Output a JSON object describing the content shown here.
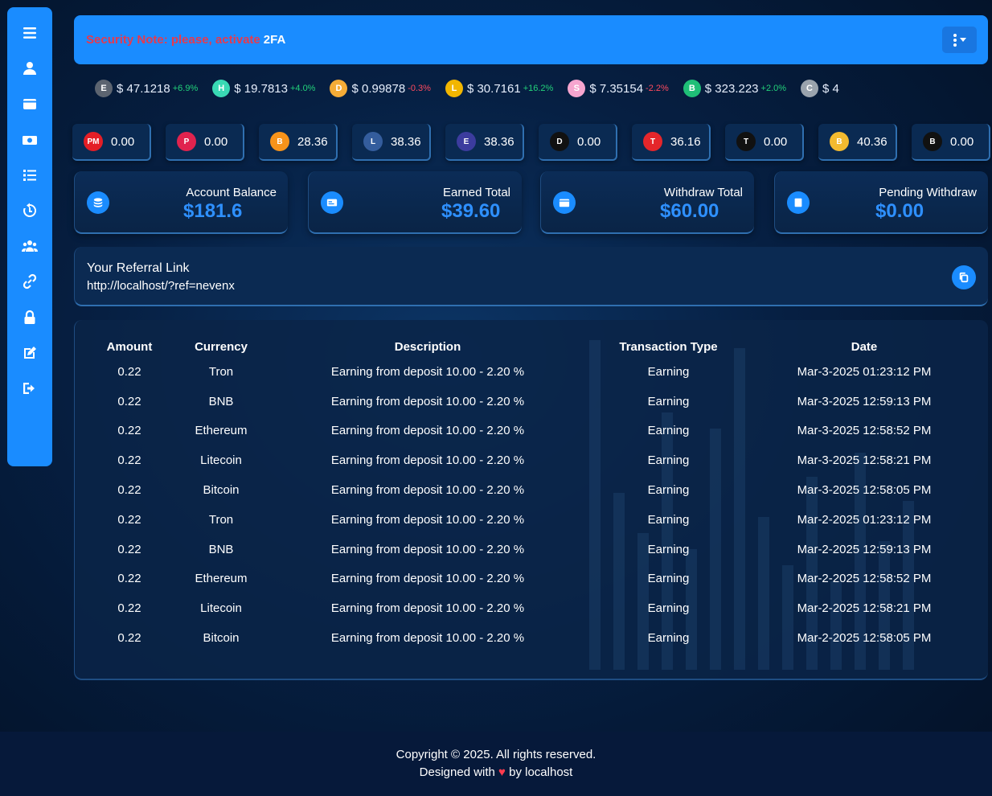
{
  "security": {
    "note": "Security Note: please, activate",
    "strong": "2FA"
  },
  "ticker": [
    {
      "icon": "ethereum-classic-icon",
      "color": "#5c6470",
      "glyph": "E",
      "price": "$ 47.1218",
      "change": "+6.9%",
      "dir": "up"
    },
    {
      "icon": "hedera-icon",
      "color": "#39d9b4",
      "glyph": "H",
      "price": "$ 19.7813",
      "change": "+4.0%",
      "dir": "up"
    },
    {
      "icon": "dai-icon",
      "color": "#f5ac37",
      "glyph": "D",
      "price": "$ 0.99878",
      "change": "-0.3%",
      "dir": "down"
    },
    {
      "icon": "terra-icon",
      "color": "#f2b600",
      "glyph": "L",
      "price": "$ 30.7161",
      "change": "+16.2%",
      "dir": "up"
    },
    {
      "icon": "shiba-icon",
      "color": "#f6a5cf",
      "glyph": "S",
      "price": "$ 7.35154",
      "change": "-2.2%",
      "dir": "down"
    },
    {
      "icon": "bitcoin-cash-icon",
      "color": "#1fbf77",
      "glyph": "B",
      "price": "$ 323.223",
      "change": "+2.0%",
      "dir": "up"
    },
    {
      "icon": "chainlink-icon",
      "color": "#9aa3ad",
      "glyph": "C",
      "price": "$ 4",
      "change": "",
      "dir": "up"
    }
  ],
  "wallets": [
    {
      "icon": "perfect-money-icon",
      "color": "#e41e26",
      "glyph": "PM",
      "value": "0.00"
    },
    {
      "icon": "payeer-icon",
      "color": "#e0234e",
      "glyph": "P",
      "value": "0.00"
    },
    {
      "icon": "bitcoin-icon",
      "color": "#f7931a",
      "glyph": "B",
      "value": "28.36"
    },
    {
      "icon": "litecoin-icon",
      "color": "#345d9d",
      "glyph": "L",
      "value": "38.36"
    },
    {
      "icon": "ethereum-icon",
      "color": "#3c3c9e",
      "glyph": "E",
      "value": "38.36"
    },
    {
      "icon": "dash-icon",
      "color": "#111111",
      "glyph": "D",
      "value": "0.00"
    },
    {
      "icon": "tron-icon",
      "color": "#e5262b",
      "glyph": "T",
      "value": "36.16"
    },
    {
      "icon": "tron-alt-icon",
      "color": "#111111",
      "glyph": "T",
      "value": "0.00"
    },
    {
      "icon": "bnb-icon",
      "color": "#f3ba2f",
      "glyph": "B",
      "value": "40.36"
    },
    {
      "icon": "bnb-alt-icon",
      "color": "#111111",
      "glyph": "B",
      "value": "0.00"
    }
  ],
  "stats": [
    {
      "label": "Account Balance",
      "value": "$181.6",
      "icon": "coins-icon"
    },
    {
      "label": "Earned Total",
      "value": "$39.60",
      "icon": "money-card-icon"
    },
    {
      "label": "Withdraw Total",
      "value": "$60.00",
      "icon": "wallet-icon"
    },
    {
      "label": "Pending Withdraw",
      "value": "$0.00",
      "icon": "pending-icon"
    }
  ],
  "referral": {
    "title": "Your Referral Link",
    "link": "http://localhost/?ref=nevenx"
  },
  "table": {
    "headers": [
      "Amount",
      "Currency",
      "Description",
      "Transaction Type",
      "Date"
    ],
    "rows": [
      [
        "0.22",
        "Tron",
        "Earning from deposit 10.00 - 2.20 %",
        "Earning",
        "Mar-3-2025 01:23:12 PM"
      ],
      [
        "0.22",
        "BNB",
        "Earning from deposit 10.00 - 2.20 %",
        "Earning",
        "Mar-3-2025 12:59:13 PM"
      ],
      [
        "0.22",
        "Ethereum",
        "Earning from deposit 10.00 - 2.20 %",
        "Earning",
        "Mar-3-2025 12:58:52 PM"
      ],
      [
        "0.22",
        "Litecoin",
        "Earning from deposit 10.00 - 2.20 %",
        "Earning",
        "Mar-3-2025 12:58:21 PM"
      ],
      [
        "0.22",
        "Bitcoin",
        "Earning from deposit 10.00 - 2.20 %",
        "Earning",
        "Mar-3-2025 12:58:05 PM"
      ],
      [
        "0.22",
        "Tron",
        "Earning from deposit 10.00 - 2.20 %",
        "Earning",
        "Mar-2-2025 01:23:12 PM"
      ],
      [
        "0.22",
        "BNB",
        "Earning from deposit 10.00 - 2.20 %",
        "Earning",
        "Mar-2-2025 12:59:13 PM"
      ],
      [
        "0.22",
        "Ethereum",
        "Earning from deposit 10.00 - 2.20 %",
        "Earning",
        "Mar-2-2025 12:58:52 PM"
      ],
      [
        "0.22",
        "Litecoin",
        "Earning from deposit 10.00 - 2.20 %",
        "Earning",
        "Mar-2-2025 12:58:21 PM"
      ],
      [
        "0.22",
        "Bitcoin",
        "Earning from deposit 10.00 - 2.20 %",
        "Earning",
        "Mar-2-2025 12:58:05 PM"
      ]
    ]
  },
  "footer": {
    "copyright": "Copyright © 2025. All rights reserved.",
    "designed_prefix": "Designed with",
    "heart": "♥",
    "designed_suffix": "by localhost"
  },
  "colors": {
    "accent": "#1a8cff",
    "value_blue": "#2e90ff",
    "warn": "#e63a4e",
    "up": "#22d17a",
    "down": "#ff4a5e"
  }
}
